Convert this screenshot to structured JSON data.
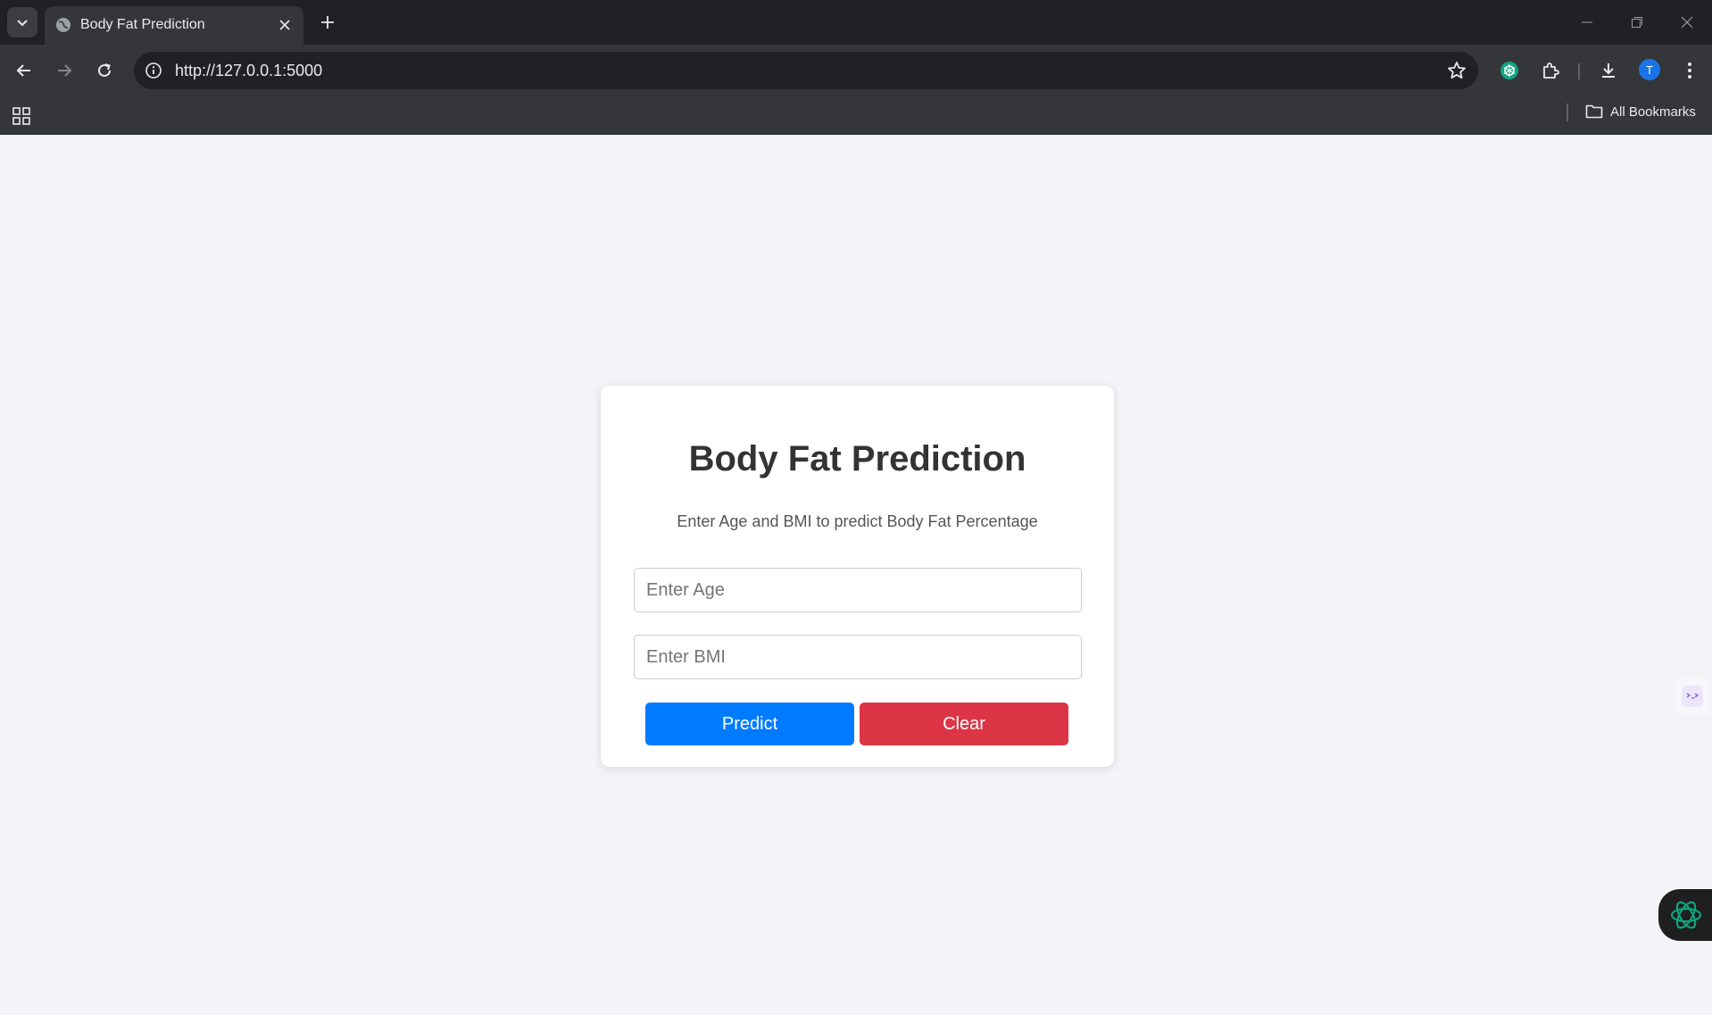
{
  "browser": {
    "tab_title": "Body Fat Prediction",
    "url": "http://127.0.0.1:5000",
    "profile_initial": "T",
    "bookmarks_label": "All Bookmarks"
  },
  "page": {
    "title": "Body Fat Prediction",
    "subtitle": "Enter Age and BMI to predict Body Fat Percentage",
    "age_input": {
      "value": "",
      "placeholder": "Enter Age"
    },
    "bmi_input": {
      "value": "",
      "placeholder": "Enter BMI"
    },
    "predict_label": "Predict",
    "clear_label": "Clear"
  },
  "colors": {
    "predict": "#007bff",
    "clear": "#dc3545",
    "chatgpt_green": "#10a37f"
  },
  "icons": [
    "tab-list-icon",
    "globe-icon",
    "close-icon",
    "plus-icon",
    "minimize-icon",
    "restore-icon",
    "window-close-icon",
    "back-icon",
    "forward-icon",
    "reload-icon",
    "info-icon",
    "star-icon",
    "chatgpt-icon",
    "extensions-icon",
    "download-icon",
    "menu-icon",
    "apps-icon",
    "folder-icon",
    "side-extension-icon"
  ]
}
